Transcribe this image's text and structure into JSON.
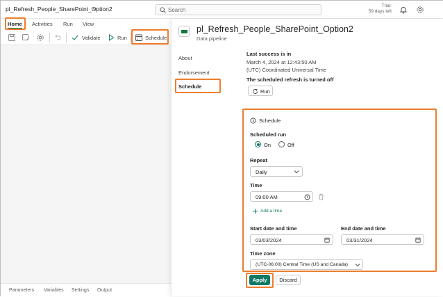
{
  "header": {
    "pipeline_name": "pl_Refresh_People_SharePoint_Option2",
    "search_placeholder": "Search",
    "trial_line1": "Trial:",
    "trial_line2": "59 days left"
  },
  "ribbon": {
    "tabs": [
      "Home",
      "Activities",
      "Run",
      "View"
    ],
    "validate_label": "Validate",
    "run_label": "Run",
    "schedule_label": "Schedule"
  },
  "bottom_tabs": [
    "Parameters",
    "Variables",
    "Settings",
    "Output"
  ],
  "panel": {
    "title": "pl_Refresh_People_SharePoint_Option2",
    "subtitle": "Data pipeline",
    "nav": [
      "About",
      "Endorsement",
      "Schedule"
    ],
    "last_success_heading": "Last success is in",
    "last_success_date": "March 4, 2024 at 12:43:50 AM",
    "last_success_tz": "(UTC) Coordinated Universal Time",
    "refresh_status": "The scheduled refresh is turned off",
    "run_button": "Run"
  },
  "schedule": {
    "heading": "Schedule",
    "scheduled_run_label": "Scheduled run",
    "on_label": "On",
    "off_label": "Off",
    "selected": "On",
    "repeat_label": "Repeat",
    "repeat_value": "Daily",
    "time_label": "Time",
    "time_value": "09:00  AM",
    "add_time": "Add a time",
    "start_label": "Start date and time",
    "start_value": "03/03/2024",
    "end_label": "End date and time",
    "end_value": "03/31/2024",
    "tz_label": "Time zone",
    "tz_value": "(UTC-06:00) Central Time (US and Canada)",
    "apply_button": "Apply",
    "discard_button": "Discard"
  },
  "colors": {
    "accent": "#117865",
    "highlight": "#ee7d2e"
  }
}
